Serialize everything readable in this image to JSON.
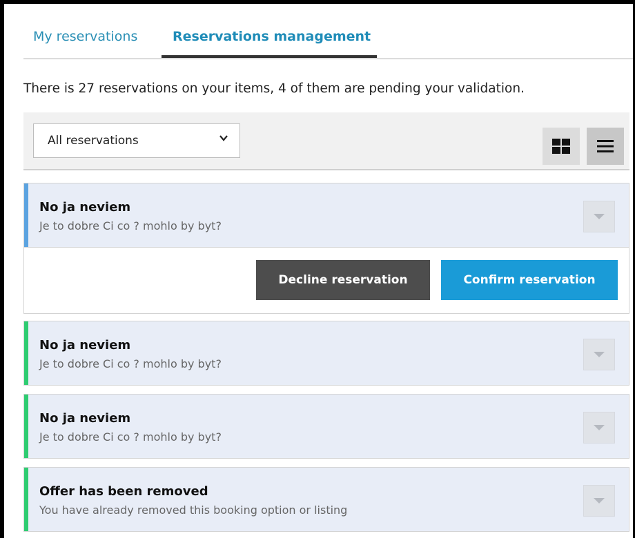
{
  "tabs": {
    "my_reservations": "My reservations",
    "reservations_management": "Reservations management"
  },
  "summary": "There is 27 reservations on your items, 4 of them are pending your validation.",
  "filter": {
    "selected": "All reservations"
  },
  "view_toggle": {
    "grid": "grid-view-icon",
    "list": "list-view-icon"
  },
  "cards": [
    {
      "title": "No ja neviem",
      "subtitle": "Je to dobre Ci co ? mohlo by byt?",
      "accent": "#5ba3e0",
      "decline_label": "Decline reservation",
      "confirm_label": "Confirm reservation"
    },
    {
      "title": "No ja neviem",
      "subtitle": "Je to dobre Ci co ? mohlo by byt?",
      "accent": "#2ecc71"
    },
    {
      "title": "No ja neviem",
      "subtitle": "Je to dobre Ci co ? mohlo by byt?",
      "accent": "#2ecc71"
    },
    {
      "title": "Offer has been removed",
      "subtitle": "You have already removed this booking option or listing",
      "accent": "#2ecc71"
    }
  ]
}
